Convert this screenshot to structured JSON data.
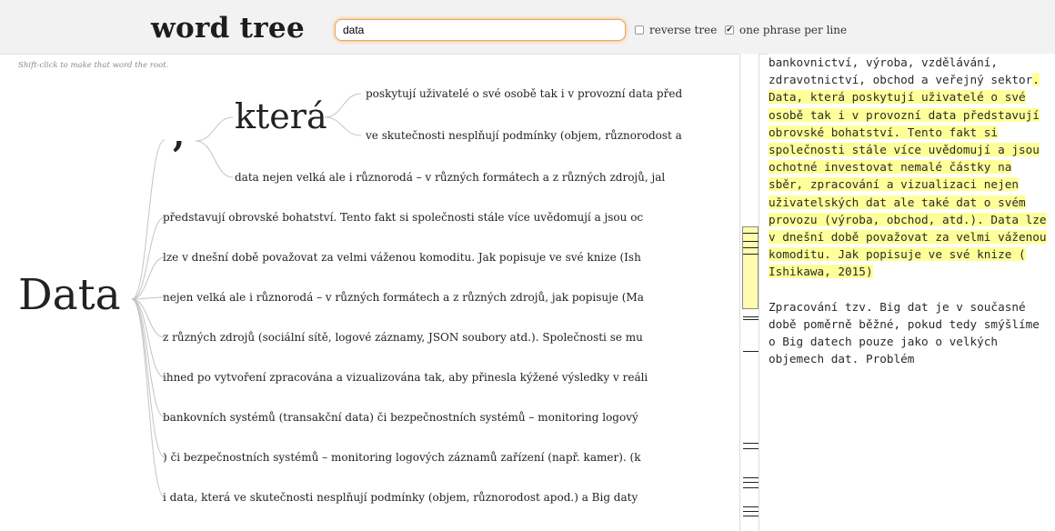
{
  "header": {
    "title": "word tree",
    "search_value": "data",
    "reverse_label": "reverse tree",
    "reverse_checked": false,
    "one_phrase_label": "one phrase per line",
    "one_phrase_checked": true
  },
  "hint": "Shift-click to make that word the root.",
  "tree": {
    "root": "Data",
    "comma": ",",
    "ktera": "která",
    "ktera_children": [
      "poskytují uživatelé o své osobě tak i v provozní data před",
      "ve skutečnosti nesplňují podmínky (objem, různorodost a"
    ],
    "comma_children": [
      "data nejen velká ale i různorodá – v různých formátech a z různých zdrojů, jal"
    ],
    "root_children": [
      "představují obrovské bohatství. Tento fakt si společnosti stále více uvědomují a jsou oc",
      "lze v dnešní době považovat za velmi váženou komoditu. Jak popisuje ve své knize (Ish",
      "nejen velká ale i různorodá – v různých formátech a z různých zdrojů, jak popisuje (Ma",
      "z různých zdrojů (sociální sítě, logové záznamy, JSON soubory atd.). Společnosti se mu",
      "ihned po vytvoření zpracována a vizualizována tak, aby přinesla kýžené výsledky v reáli",
      "bankovních systémů (transakční data) či bezpečnostních systémů – monitoring logový",
      ") či bezpečnostních systémů – monitoring logových záznamů zařízení (např. kamer). (k",
      "i data, která ve skutečnosti nesplňují podmínky (objem, různorodost apod.) a Big daty"
    ]
  },
  "document": {
    "para1_plain": "bankovnictví, výroba, vzdělávání, zdravotnictví, obchod a veřejný sektor",
    "para1_highlight": ". Data, která poskytují uživatelé o své osobě tak i v provozní data představují obrovské bohatství. Tento fakt si společnosti stále více uvědomují a jsou ochotné investovat nemalé částky na sběr, zpracování a vizualizaci nejen uživatelských dat ale také dat o svém provozu (výroba, obchod, atd.). Data lze v dnešní době považovat za velmi váženou komoditu. Jak popisuje ve své knize ( Ishikawa, 2015)",
    "para2": "Zpracování tzv. Big dat je v současné době poměrně běžné, pokud tedy smýšlíme o Big datech pouze jako o velkých objemech dat. Problém"
  },
  "colors": {
    "search_border": "#f2a657",
    "highlight": "#ffff99",
    "minimap_viewport": "#fffcb0",
    "header_bg": "#f2f2f2"
  },
  "icons": {
    "reverse_checkbox": "checkbox-unchecked-icon",
    "one_phrase_checkbox": "checkbox-checked-icon"
  }
}
